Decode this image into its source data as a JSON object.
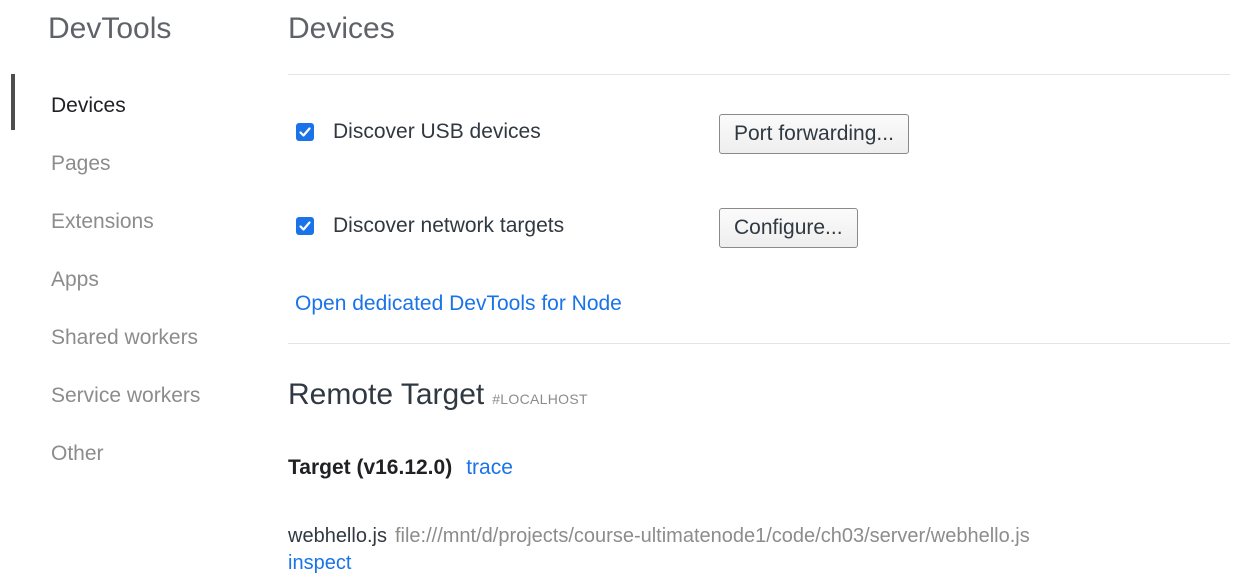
{
  "sidebar": {
    "title": "DevTools",
    "items": [
      {
        "label": "Devices",
        "selected": true
      },
      {
        "label": "Pages",
        "selected": false
      },
      {
        "label": "Extensions",
        "selected": false
      },
      {
        "label": "Apps",
        "selected": false
      },
      {
        "label": "Shared workers",
        "selected": false
      },
      {
        "label": "Service workers",
        "selected": false
      },
      {
        "label": "Other",
        "selected": false
      }
    ]
  },
  "main": {
    "title": "Devices",
    "usb": {
      "label": "Discover USB devices",
      "checked": true,
      "button": "Port forwarding..."
    },
    "network": {
      "label": "Discover network targets",
      "checked": true,
      "button": "Configure..."
    },
    "node_link": "Open dedicated DevTools for Node",
    "remote": {
      "title": "Remote Target",
      "host": "#LOCALHOST",
      "target_name": "Target (v16.12.0)",
      "trace_label": "trace",
      "file_name": "webhello.js",
      "file_url": "file:///mnt/d/projects/course-ultimatenode1/code/ch03/server/webhello.js",
      "inspect_label": "inspect"
    }
  },
  "colors": {
    "accent": "#1a73e8",
    "text": "#303942",
    "muted": "#8c8c8c",
    "selection_bar": "#4d4d4d"
  },
  "icons": {
    "checkbox": "checkmark-icon"
  }
}
